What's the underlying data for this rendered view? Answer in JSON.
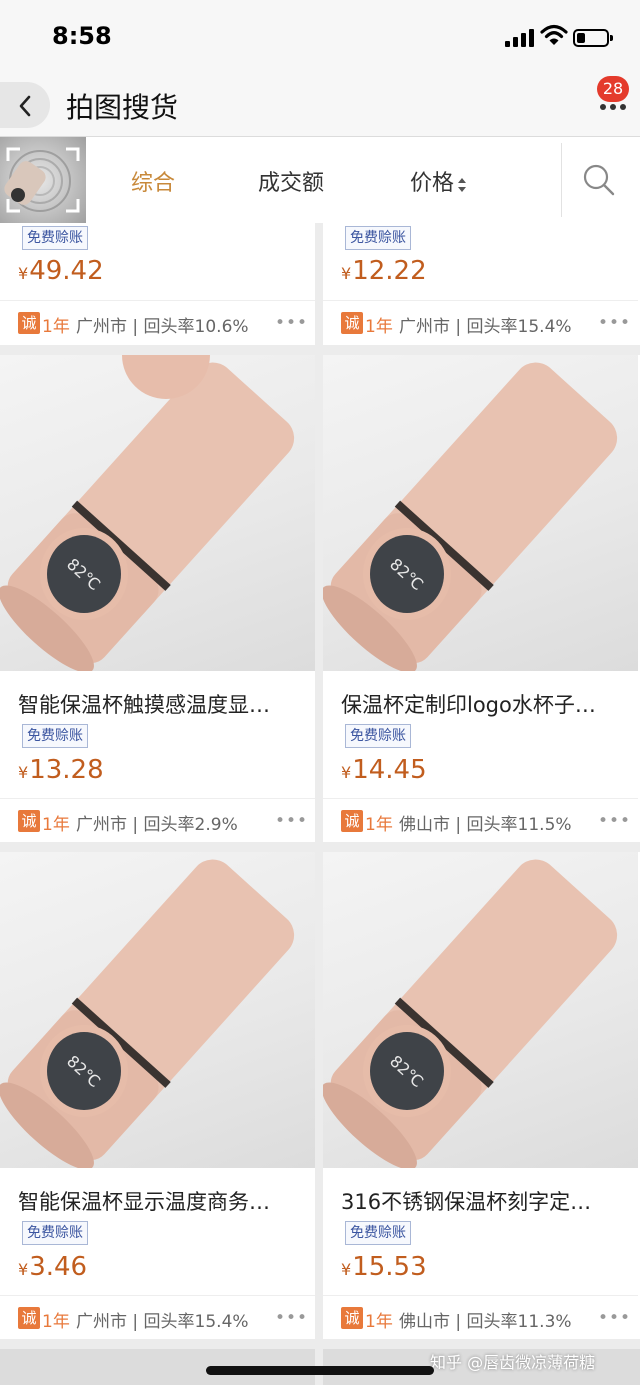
{
  "status_bar": {
    "time": "8:58"
  },
  "header": {
    "title": "拍图搜货",
    "message_badge": "28"
  },
  "filters": {
    "tabs": [
      "综合",
      "成交额",
      "价格"
    ],
    "active": "综合",
    "price_sort_icon": "sort-up-down-icon",
    "search_icon": "search-icon"
  },
  "colors": {
    "accent": "#c8893a",
    "price": "#c15d1e",
    "cheng_badge": "#e8793b",
    "tag_border": "#a9b7d6"
  },
  "products": [
    {
      "title": "",
      "tag": "免费赊账",
      "price": "49.42",
      "cheng": "诚",
      "years": "1年",
      "meta": "广州市 | 回头率10.6%",
      "more": "•••"
    },
    {
      "title": "",
      "tag": "免费赊账",
      "price": "12.22",
      "cheng": "诚",
      "years": "1年",
      "meta": "广州市 | 回头率15.4%",
      "more": "•••"
    },
    {
      "title": "智能保温杯触摸感温度显…",
      "tag": "免费赊账",
      "price": "13.28",
      "cheng": "诚",
      "years": "1年",
      "meta": "广州市 | 回头率2.9%",
      "more": "•••",
      "image_text": "82℃"
    },
    {
      "title": "保温杯定制印logo水杯子…",
      "tag": "免费赊账",
      "price": "14.45",
      "cheng": "诚",
      "years": "1年",
      "meta": "佛山市 | 回头率11.5%",
      "more": "•••",
      "image_text": "82℃"
    },
    {
      "title": "智能保温杯显示温度商务…",
      "tag": "免费赊账",
      "price": "3.46",
      "cheng": "诚",
      "years": "1年",
      "meta": "广州市 | 回头率15.4%",
      "more": "•••",
      "image_text": "82℃"
    },
    {
      "title": "316不锈钢保温杯刻字定…",
      "tag": "免费赊账",
      "price": "15.53",
      "cheng": "诚",
      "years": "1年",
      "meta": "佛山市 | 回头率11.3%",
      "more": "•••",
      "image_text": "82℃"
    }
  ],
  "currency": "¥",
  "watermark": "知乎 @唇齿微凉薄荷糖"
}
